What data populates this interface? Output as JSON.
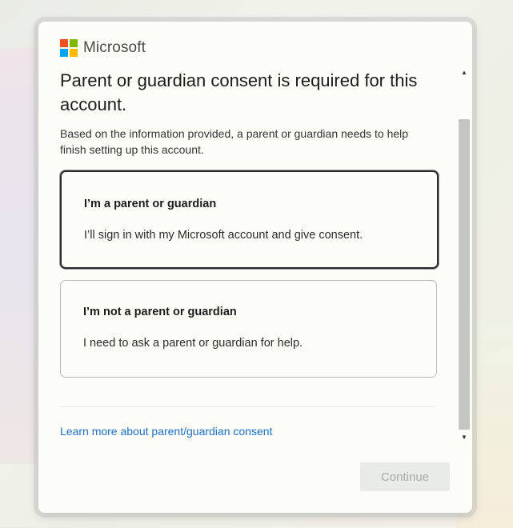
{
  "brand": {
    "name": "Microsoft",
    "logo_colors": [
      "#f25022",
      "#7fba00",
      "#00a4ef",
      "#ffb900"
    ]
  },
  "dialog": {
    "title": "Parent or guardian consent is required for this account.",
    "subtitle": "Based on the information provided, a parent or guardian needs to help finish setting up this account."
  },
  "options": [
    {
      "title": "I’m a parent or guardian",
      "description": "I’ll sign in with my Microsoft account and give consent.",
      "selected": true
    },
    {
      "title": "I’m not a parent or guardian",
      "description": "I need to ask a parent or guardian for help.",
      "selected": false
    }
  ],
  "links": {
    "learn_more": "Learn more about parent/guardian consent"
  },
  "actions": {
    "continue_label": "Continue",
    "continue_enabled": false
  },
  "colors": {
    "link": "#1f6fc4",
    "disabled_button_bg": "#e8ebe6",
    "disabled_button_text": "#a6aaa6"
  },
  "icons": {
    "scroll_up": "scroll-up-arrow-icon",
    "scroll_down": "scroll-down-arrow-icon"
  }
}
